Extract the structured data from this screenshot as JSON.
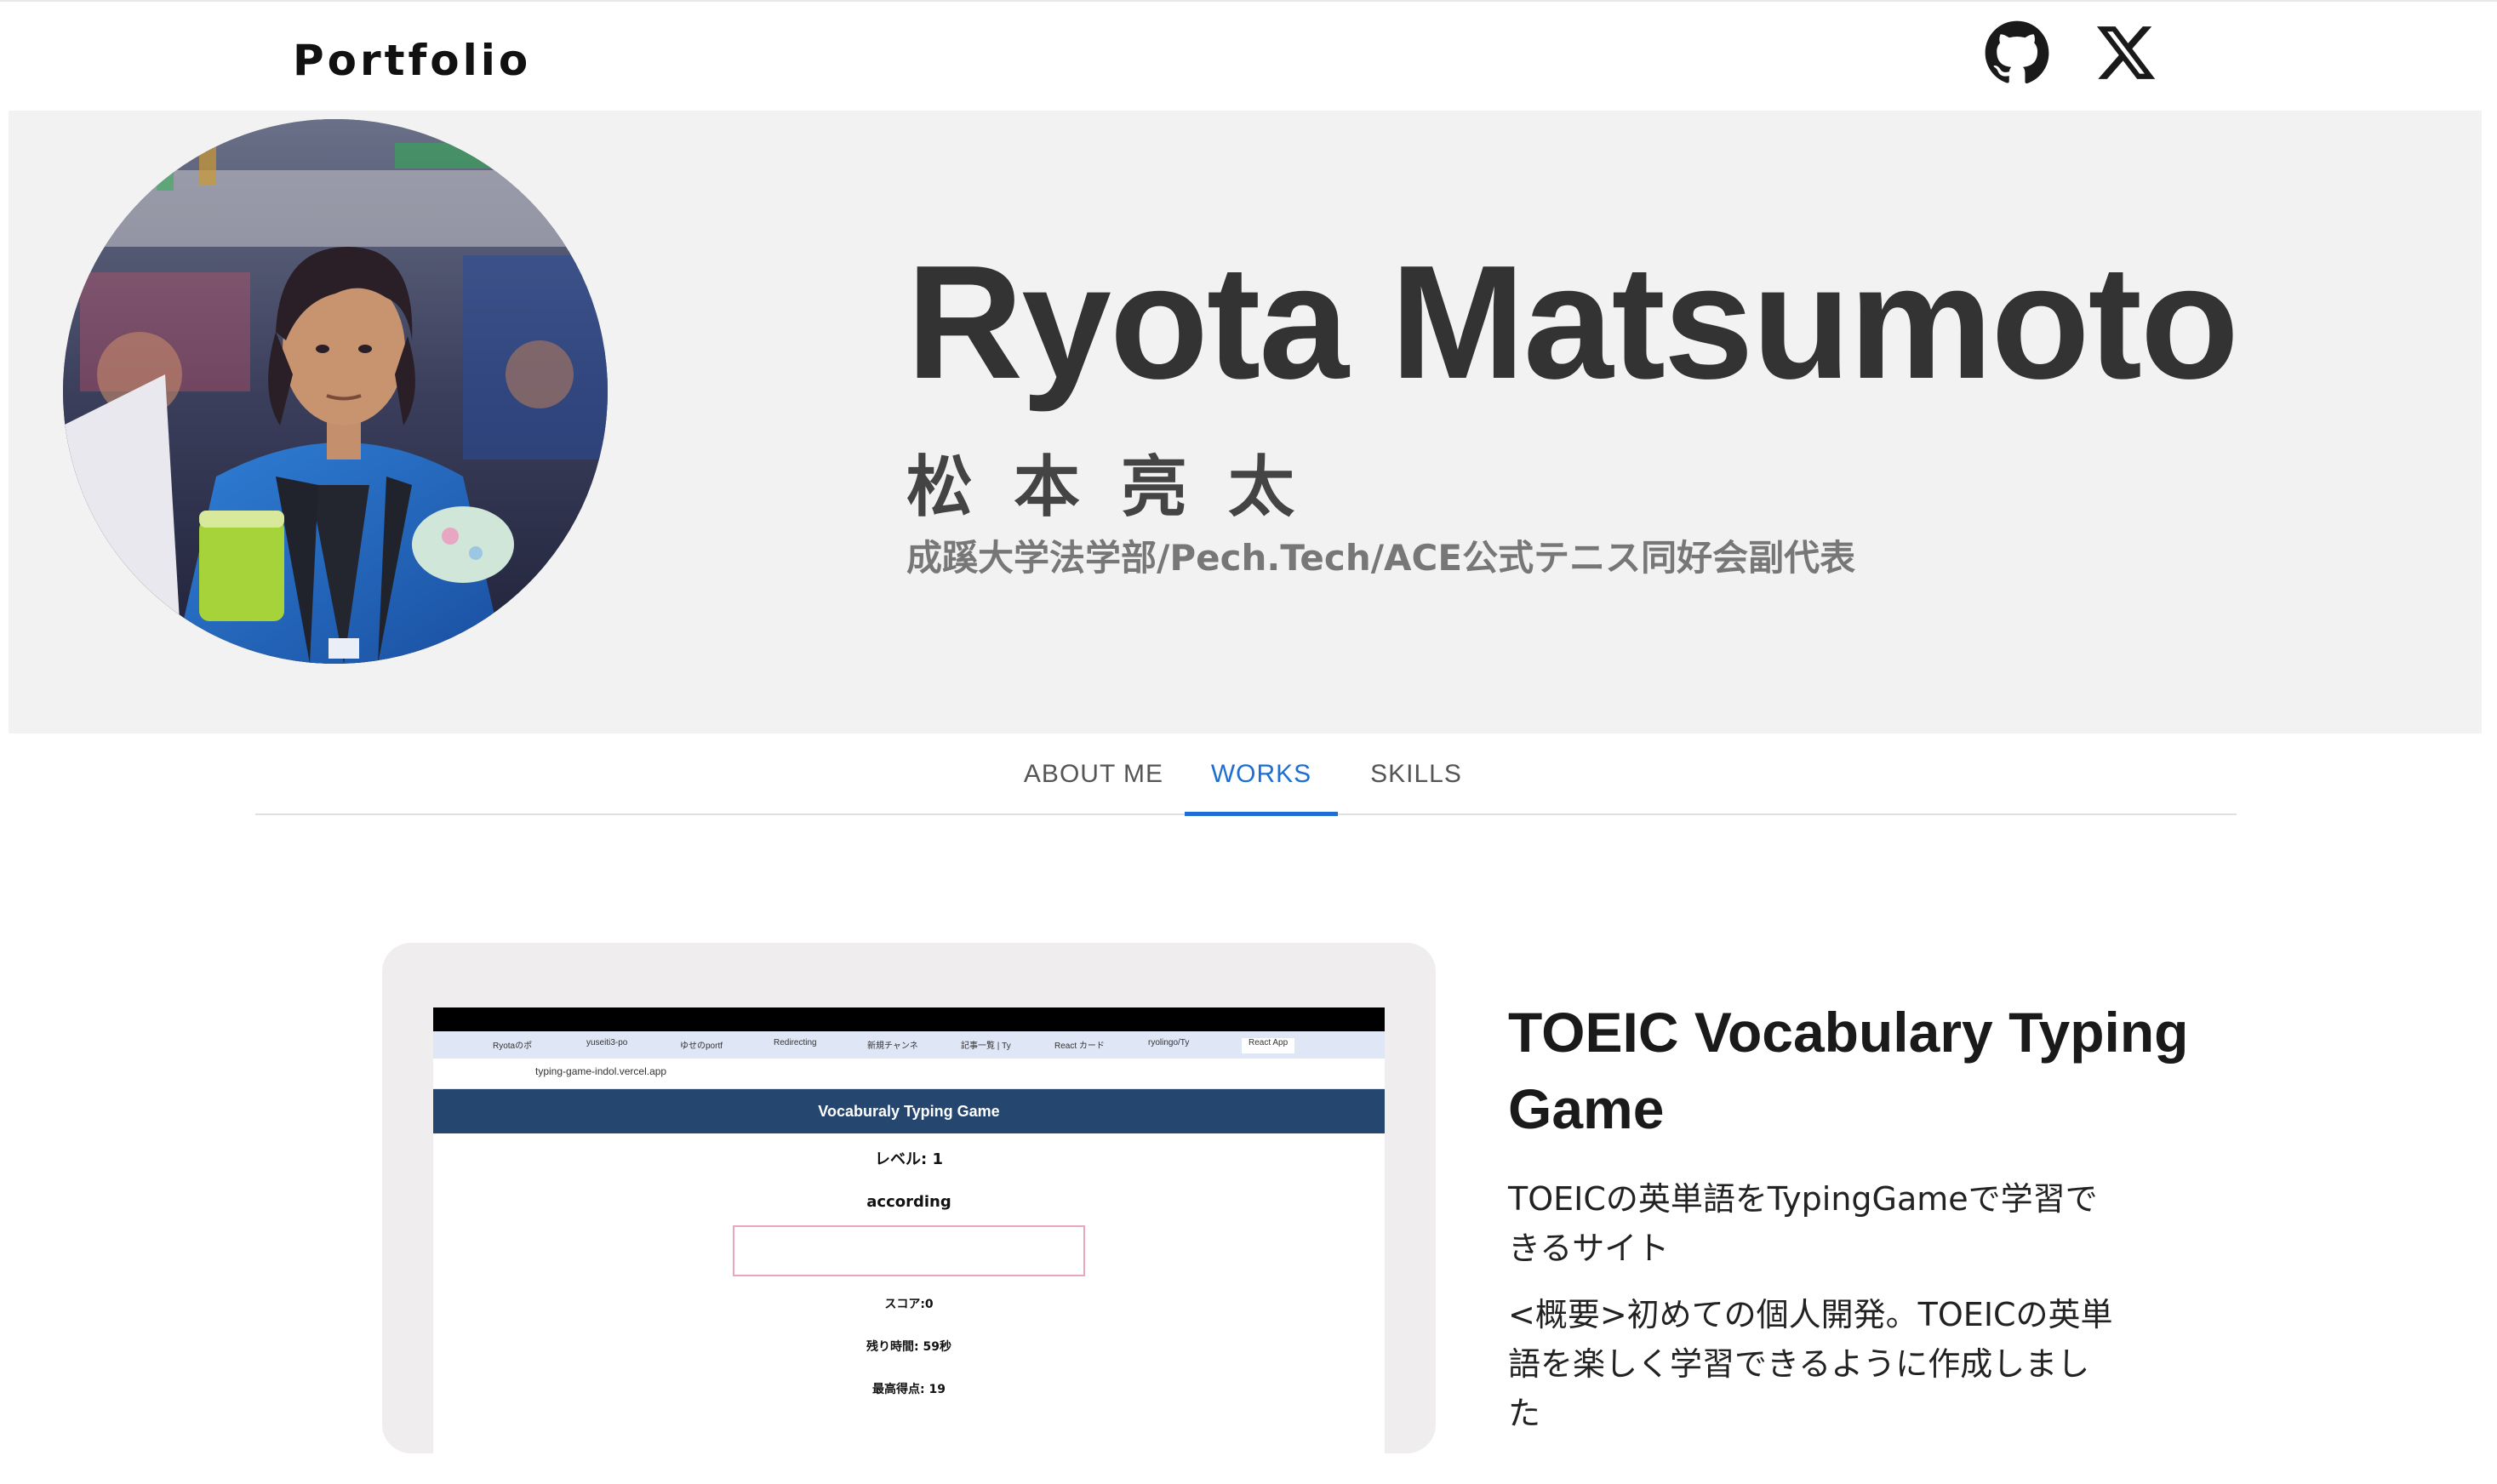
{
  "header": {
    "brand": "Portfolio",
    "social": [
      {
        "name": "GitHub",
        "icon": "github-icon"
      },
      {
        "name": "X",
        "icon": "x-icon"
      }
    ]
  },
  "hero": {
    "name_en": "Ryota Matsumoto",
    "name_jp": "松本亮太",
    "affiliation": "成蹊大学法学部/Pech.Tech/ACE公式テニス同好会副代表"
  },
  "tabs": {
    "items": [
      "ABOUT ME",
      "WORKS",
      "SKILLS"
    ],
    "active": "WORKS"
  },
  "work": {
    "screenshot": {
      "url": "typing-game-indol.vercel.app",
      "app_title": "Vocaburaly Typing Game",
      "level": "レベル: 1",
      "word": "according",
      "score": "スコア:0",
      "time_left": "残り時間: 59秒",
      "high_score": "最高得点: 19",
      "browser_tabs": [
        "Ryotaのポ",
        "yuseiti3-po",
        "ゆせのportf",
        "Redirecting",
        "新規チャンネ",
        "記事一覧 | Ty",
        "React カード",
        "ryolingo/Ty",
        "React App"
      ]
    },
    "title": "TOEIC Vocabulary Typing Game",
    "description": "TOEICの英単語をTypingGameで学習できるサイト",
    "overview": "<概要>初めての個人開発。TOEICの英単語を楽しく学習できるように作成しました"
  },
  "colors": {
    "accent": "#1e6fd0",
    "hero_bg": "#f2f2f2",
    "card_bg": "#efeded",
    "app_header": "#24466f"
  }
}
